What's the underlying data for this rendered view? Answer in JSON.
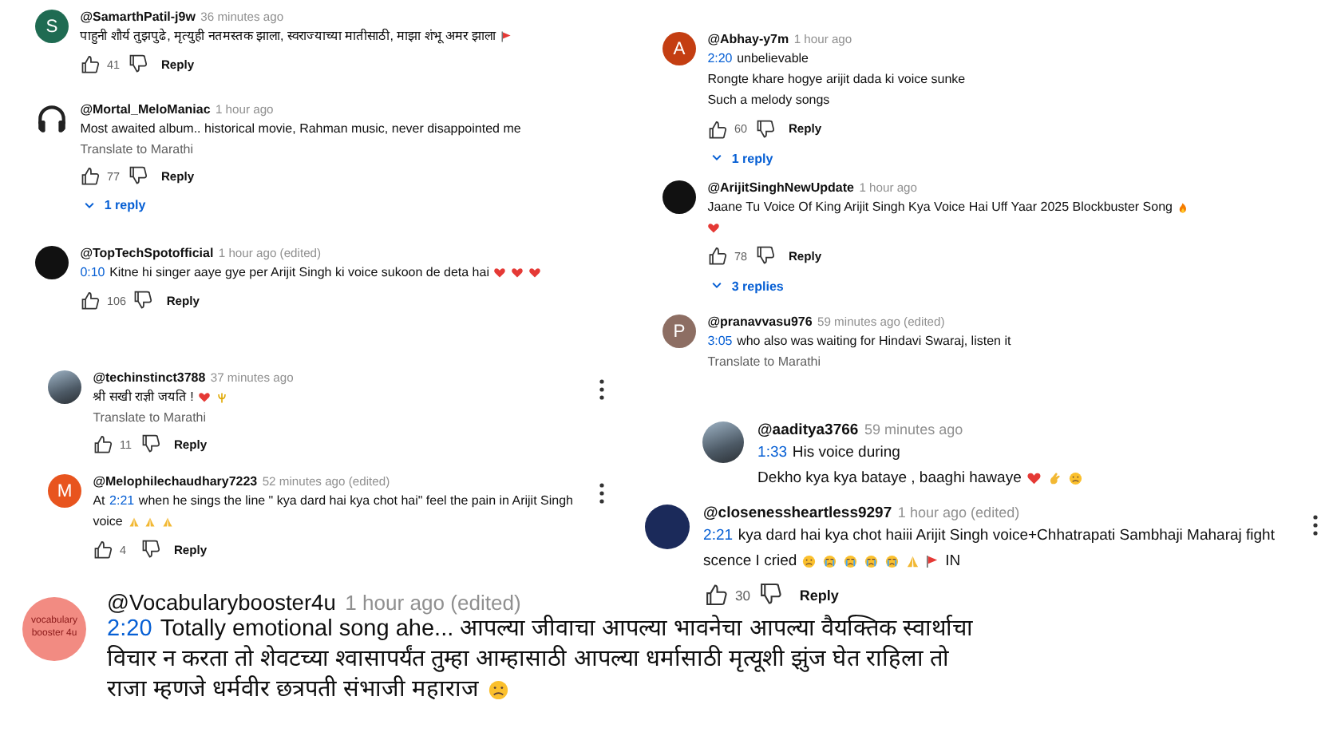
{
  "comments": [
    {
      "avatar": {
        "kind": "letter",
        "letter": "S",
        "color": "#1f6b52"
      },
      "handle": "@SamarthPatil-j9w",
      "time": "36 minutes ago",
      "lines": [
        [
          {
            "kind": "text",
            "text": "पाहुनी शौर्य तुझपुढे, मृत्युही नतमस्तक झाला, स्वराज्याच्या मातीसाठी, माझा शंभू अमर झाला"
          },
          {
            "kind": "flag"
          }
        ]
      ],
      "likes": "41",
      "reply": "Reply",
      "menu": false
    },
    {
      "avatar": {
        "kind": "headphones"
      },
      "handle": "@Mortal_MeloManiac",
      "time": "1 hour ago",
      "lines": [
        [
          {
            "kind": "text",
            "text": "Most awaited album.. historical movie, Rahman music, never disappointed me"
          }
        ]
      ],
      "translate": "Translate to Marathi",
      "likes": "77",
      "reply": "Reply",
      "replies": "1 reply",
      "menu": false
    },
    {
      "avatar": {
        "kind": "dark"
      },
      "handle": "@TopTechSpotofficial",
      "time": "1 hour ago (edited)",
      "lines": [
        [
          {
            "kind": "time",
            "text": "0:10"
          },
          {
            "kind": "text",
            "text": "Kitne hi singer aaye gye per Arijit Singh ki voice sukoon de deta hai"
          },
          {
            "kind": "heart"
          },
          {
            "kind": "heart"
          },
          {
            "kind": "heart"
          }
        ]
      ],
      "likes": "106",
      "reply": "Reply",
      "menu": false
    },
    {
      "avatar": {
        "kind": "photo"
      },
      "handle": "@techinstinct3788",
      "time": "37 minutes ago",
      "lines": [
        [
          {
            "kind": "text",
            "text": "श्री सखी राज्ञी जयति !"
          },
          {
            "kind": "heart"
          },
          {
            "kind": "trident"
          }
        ]
      ],
      "translate": "Translate to Marathi",
      "likes": "11",
      "reply": "Reply",
      "menu": true
    },
    {
      "avatar": {
        "kind": "letter",
        "letter": "M",
        "color": "#e8541e"
      },
      "handle": "@Melophilechaudhary7223",
      "time": "52 minutes ago (edited)",
      "lines": [
        [
          {
            "kind": "text",
            "text": "At"
          },
          {
            "kind": "time",
            "text": "2:21"
          },
          {
            "kind": "text",
            "text": "when he sings the line \" kya dard hai kya chot hai\" feel the pain in Arijit Singh"
          }
        ],
        [
          {
            "kind": "text",
            "text": "voice"
          },
          {
            "kind": "pray"
          },
          {
            "kind": "pray"
          },
          {
            "kind": "pray"
          }
        ]
      ],
      "likes": "4",
      "reply": "Reply",
      "menu": true
    },
    {
      "avatar": {
        "kind": "letter",
        "letter": "A",
        "color": "#c43e12"
      },
      "handle": "@Abhay-y7m",
      "time": "1 hour ago",
      "lines": [
        [
          {
            "kind": "time",
            "text": "2:20"
          },
          {
            "kind": "text",
            "text": "unbelievable"
          }
        ],
        [
          {
            "kind": "text",
            "text": "Rongte khare hogye arijit dada ki voice sunke"
          }
        ],
        [
          {
            "kind": "text",
            "text": "Such a melody songs"
          }
        ]
      ],
      "likes": "60",
      "reply": "Reply",
      "replies": "1 reply",
      "menu": false
    },
    {
      "avatar": {
        "kind": "dark"
      },
      "handle": "@ArijitSinghNewUpdate",
      "time": "1 hour ago",
      "lines": [
        [
          {
            "kind": "text",
            "text": "Jaane Tu Voice Of King Arijit Singh Kya Voice Hai Uff Yaar 2025 Blockbuster Song"
          },
          {
            "kind": "fire"
          }
        ],
        [
          {
            "kind": "heart"
          }
        ]
      ],
      "likes": "78",
      "reply": "Reply",
      "replies": "3 replies",
      "menu": false
    },
    {
      "avatar": {
        "kind": "letter",
        "letter": "P",
        "color": "#8d6e63"
      },
      "handle": "@pranavvasu976",
      "time": "59 minutes ago (edited)",
      "lines": [
        [
          {
            "kind": "time",
            "text": "3:05"
          },
          {
            "kind": "text",
            "text": "who also was waiting for Hindavi Swaraj, listen it"
          }
        ]
      ],
      "translate": "Translate to Marathi",
      "menu": false
    },
    {
      "avatar": {
        "kind": "photo"
      },
      "handle": "@aaditya3766",
      "time": "59 minutes ago",
      "lines": [
        [
          {
            "kind": "time",
            "text": "1:33"
          },
          {
            "kind": "text",
            "text": "His voice during"
          }
        ],
        [
          {
            "kind": "text",
            "text": "Dekho kya kya bataye , baaghi hawaye"
          },
          {
            "kind": "heart"
          },
          {
            "kind": "hand"
          },
          {
            "kind": "sad"
          }
        ]
      ],
      "menu": false
    },
    {
      "avatar": {
        "kind": "emblem"
      },
      "handle": "@closenessheartless9297",
      "time": "1 hour ago (edited)",
      "lines": [
        [
          {
            "kind": "time",
            "text": "2:21"
          },
          {
            "kind": "text",
            "text": "kya dard hai kya chot haiii Arijit Singh voice+Chhatrapati Sambhaji Maharaj fight"
          }
        ],
        [
          {
            "kind": "text",
            "text": "scence I cried"
          },
          {
            "kind": "sad"
          },
          {
            "kind": "sob"
          },
          {
            "kind": "sob"
          },
          {
            "kind": "sob"
          },
          {
            "kind": "sob"
          },
          {
            "kind": "pray"
          },
          {
            "kind": "flag"
          },
          {
            "kind": "text",
            "text": "IN"
          }
        ]
      ],
      "likes": "30",
      "reply": "Reply",
      "menu": true
    },
    {
      "avatar": {
        "kind": "text",
        "text": "vocabulary booster 4u",
        "color": "#f28b82"
      },
      "handle": "@Vocabularybooster4u",
      "time": "1 hour ago (edited)",
      "lines": [
        [
          {
            "kind": "time",
            "text": "2:20"
          },
          {
            "kind": "text",
            "text": "Totally emotional song ahe... आपल्या जीवाचा आपल्या भावनेचा आपल्या वैयक्तिक स्वार्थाचा"
          }
        ],
        [
          {
            "kind": "text",
            "text": "विचार न करता तो शेवटच्या श्वासापर्यंत तुम्हा आम्हासाठी आपल्या धर्मासाठी मृत्यूशी झुंज घेत राहिला तो"
          }
        ],
        [
          {
            "kind": "text",
            "text": "राजा म्हणजे धर्मवीर छत्रपती संभाजी महाराज"
          },
          {
            "kind": "sad"
          }
        ]
      ],
      "menu": false
    }
  ]
}
